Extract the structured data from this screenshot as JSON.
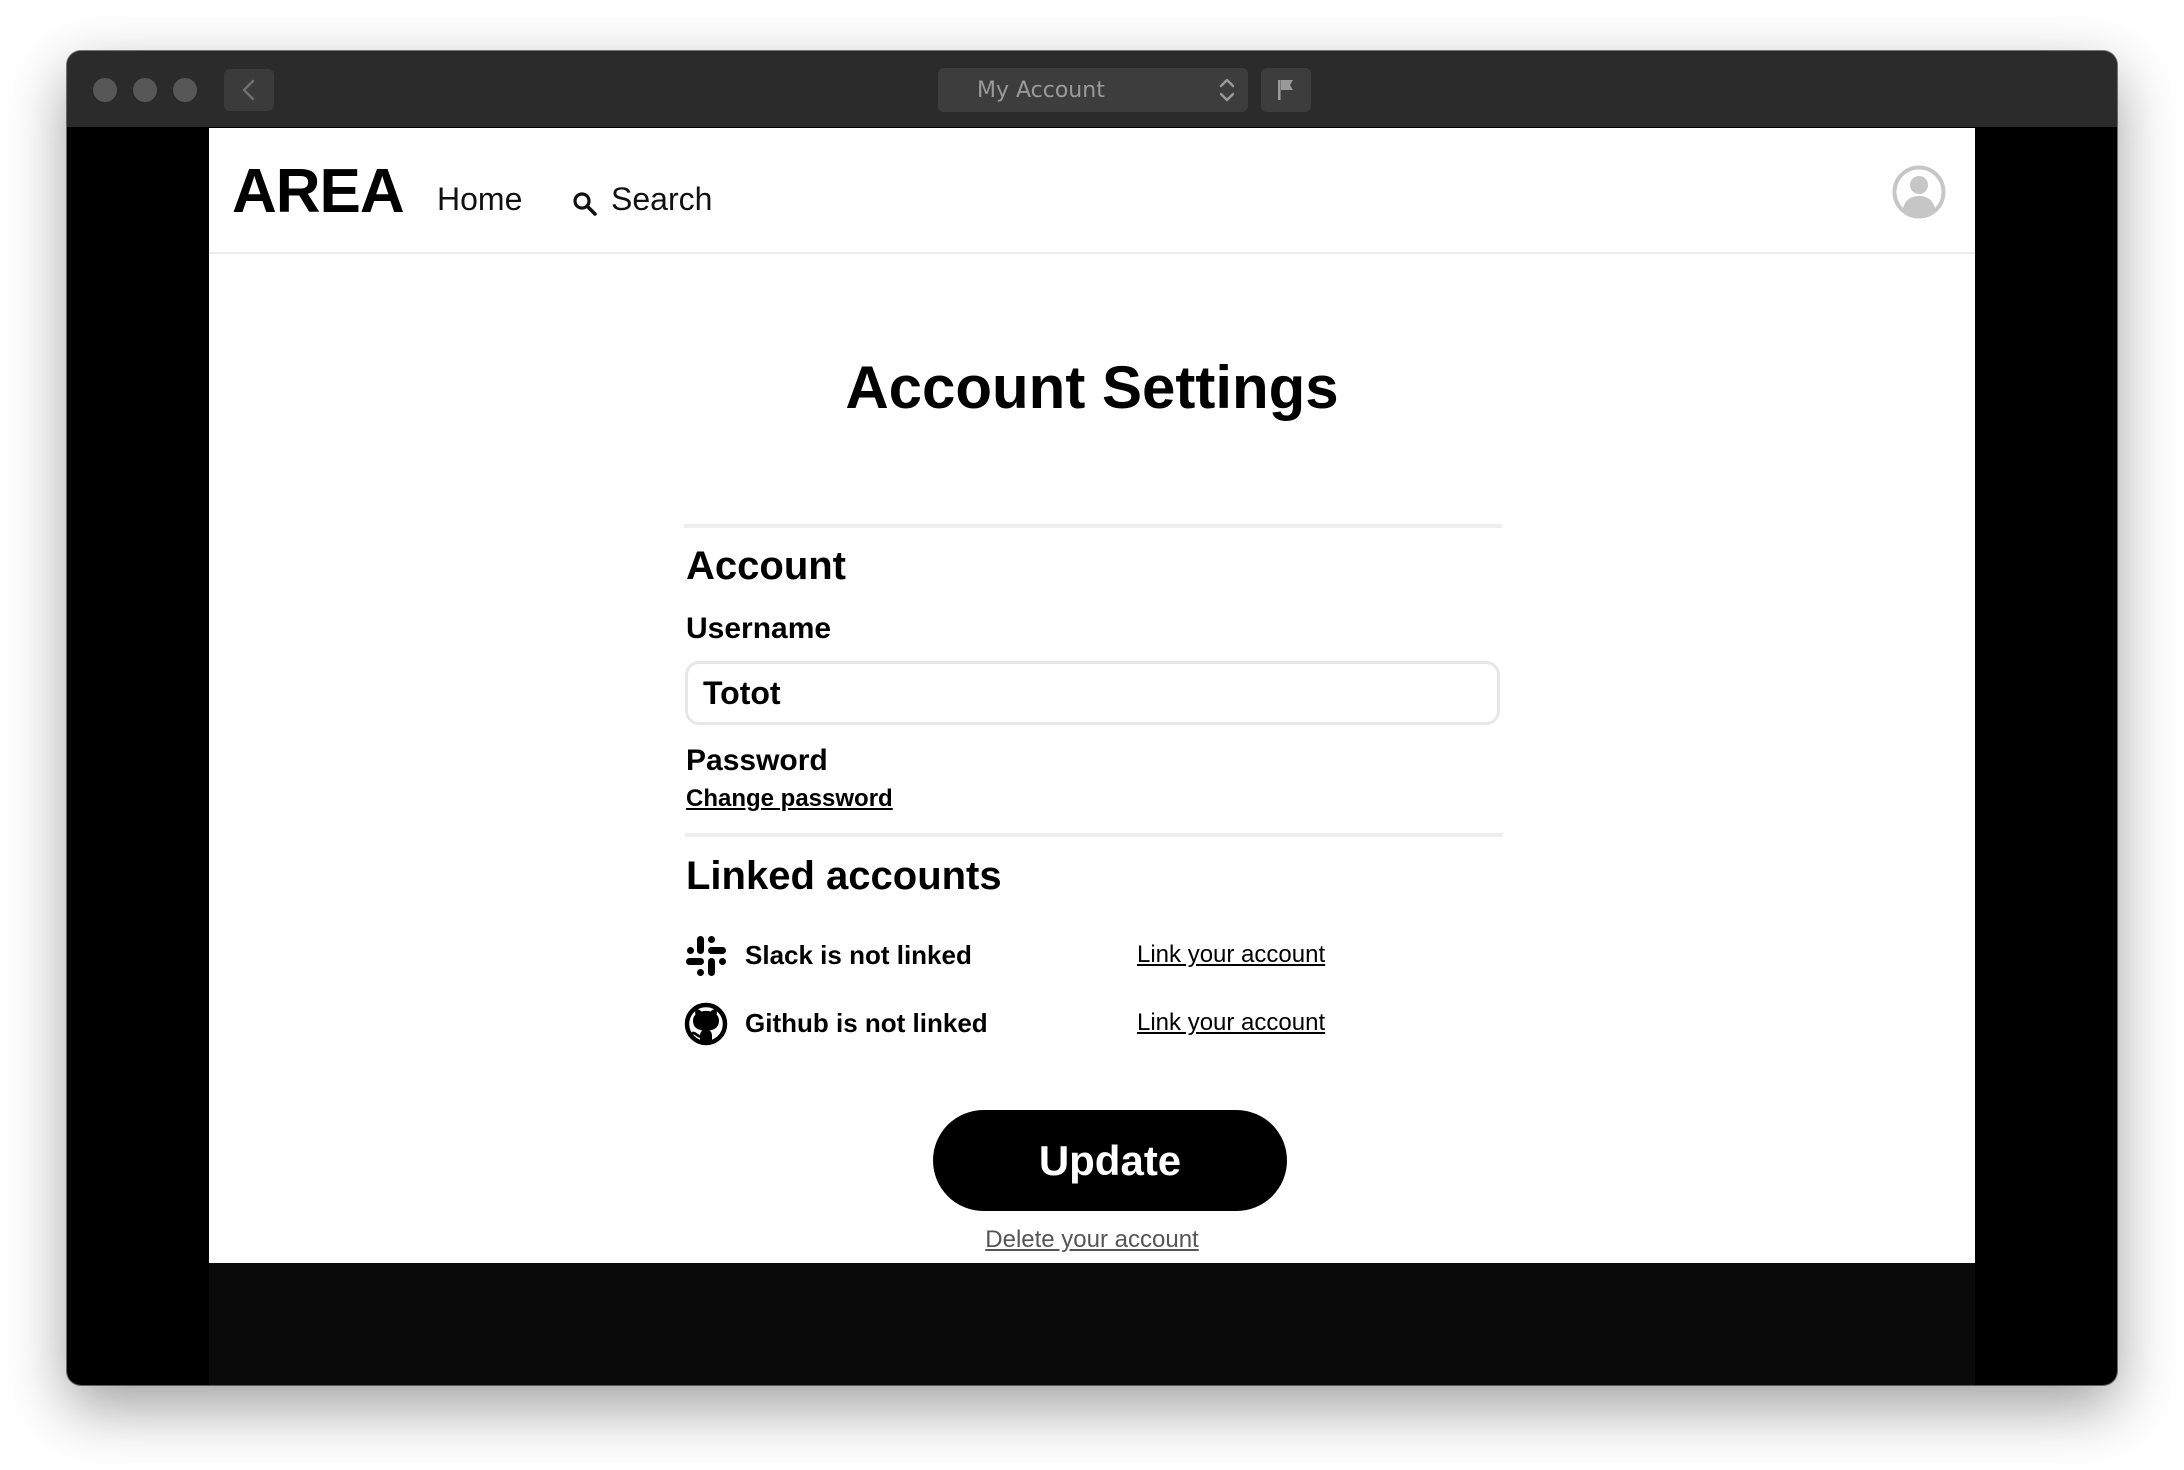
{
  "window": {
    "title_select": "My Account"
  },
  "navbar": {
    "brand": "AREA",
    "home_label": "Home",
    "search_label": "Search"
  },
  "main": {
    "title": "Account Settings",
    "account_section": {
      "heading": "Account",
      "username_label": "Username",
      "username_value": "Totot",
      "password_label": "Password",
      "change_password_link": "Change password"
    },
    "linked_section": {
      "heading": "Linked accounts",
      "services": [
        {
          "icon": "slack-icon",
          "status": "Slack is not linked",
          "link": "Link your account"
        },
        {
          "icon": "github-icon",
          "status": "Github is not linked",
          "link": "Link your account"
        }
      ]
    },
    "update_button": "Update",
    "delete_link": "Delete your account"
  },
  "colors": {
    "primary": "#000000",
    "window_chrome": "#2b2b2b",
    "divider": "#eeeeee",
    "muted_link": "#555555"
  }
}
